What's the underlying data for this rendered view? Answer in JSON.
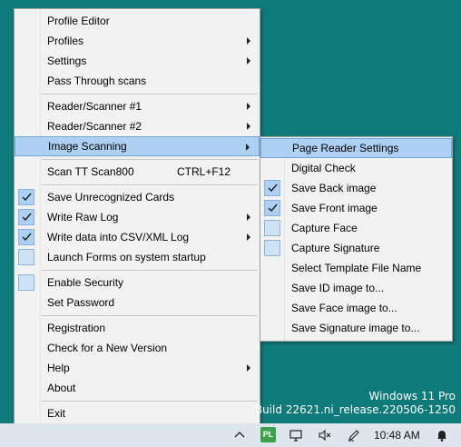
{
  "main_menu": {
    "items": [
      {
        "label": "Profile Editor"
      },
      {
        "label": "Profiles"
      },
      {
        "label": "Settings"
      },
      {
        "label": "Pass Through scans"
      },
      {
        "label": "Reader/Scanner #1"
      },
      {
        "label": "Reader/Scanner #2"
      },
      {
        "label": "Image Scanning"
      },
      {
        "label": "Scan TT Scan800",
        "shortcut": "CTRL+F12"
      },
      {
        "label": "Save Unrecognized Cards"
      },
      {
        "label": "Write Raw Log"
      },
      {
        "label": "Write data into CSV/XML Log"
      },
      {
        "label": "Launch Forms on system startup"
      },
      {
        "label": "Enable Security"
      },
      {
        "label": "Set Password"
      },
      {
        "label": "Registration"
      },
      {
        "label": "Check for a New Version"
      },
      {
        "label": "Help"
      },
      {
        "label": "About"
      },
      {
        "label": "Exit"
      }
    ]
  },
  "sub_menu": {
    "items": [
      {
        "label": "Page Reader Settings"
      },
      {
        "label": "Digital Check"
      },
      {
        "label": "Save Back image"
      },
      {
        "label": "Save Front image"
      },
      {
        "label": "Capture Face"
      },
      {
        "label": "Capture Signature"
      },
      {
        "label": "Select Template File Name"
      },
      {
        "label": "Save ID image to..."
      },
      {
        "label": "Save Face image to..."
      },
      {
        "label": "Save Signature image to..."
      }
    ]
  },
  "desktop": {
    "watermark_line1": "Windows 11 Pro",
    "watermark_line2": "Build 22621.ni_release.220506-1250"
  },
  "taskbar": {
    "app_badge": "PL",
    "time": "10:48 AM"
  },
  "colors": {
    "desktop": "#0f7a7a",
    "highlight": "#aed0f2",
    "menu_bg": "#f2f2f2"
  }
}
